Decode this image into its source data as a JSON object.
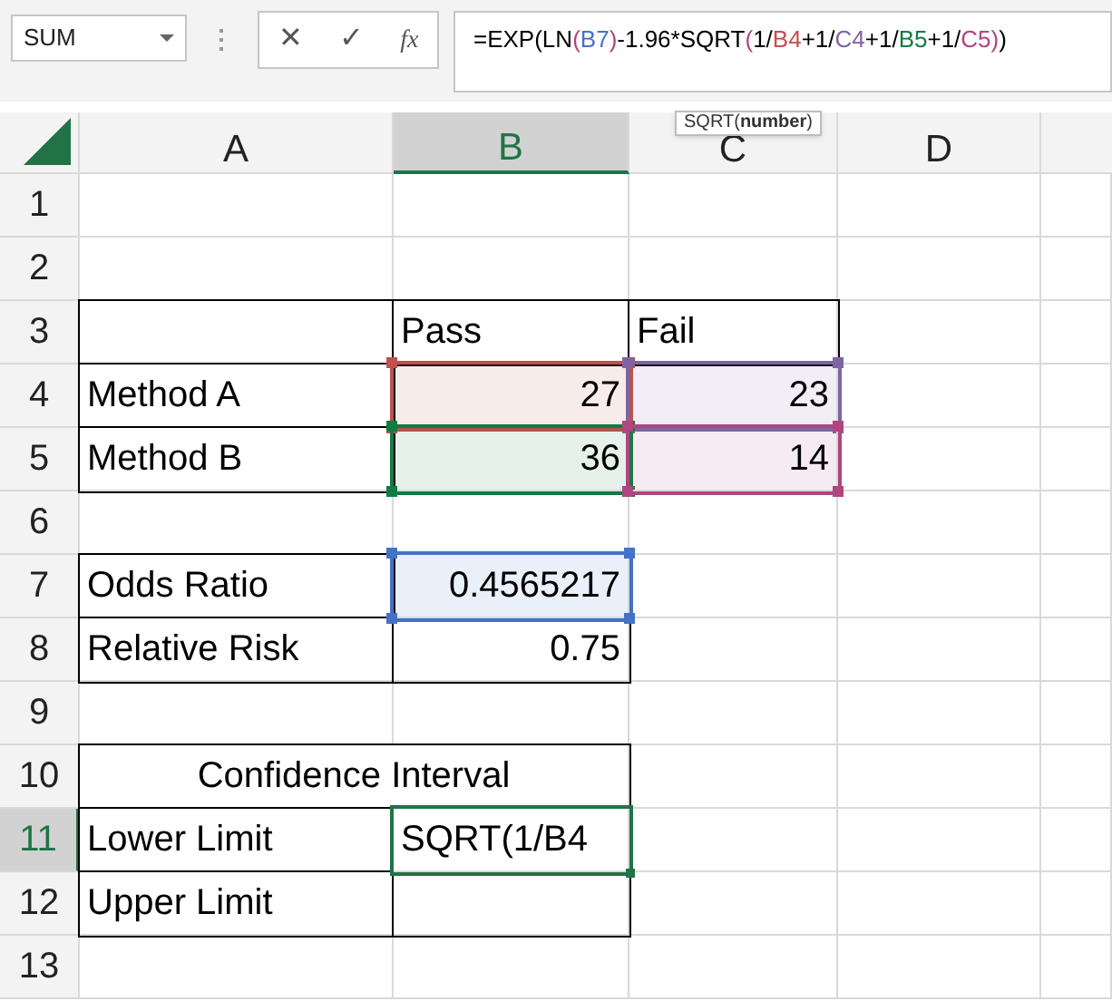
{
  "name_box": {
    "value": "SUM"
  },
  "formula_bar": {
    "buttons": [
      "✕",
      "✓",
      "fx"
    ],
    "segments": [
      {
        "text": "=EXP(LN"
      },
      {
        "text": "(",
        "color": "#b0457f"
      },
      {
        "text": "B7",
        "color": "#4472c4"
      },
      {
        "text": ")",
        "color": "#b0457f"
      },
      {
        "text": "-1.96*SQRT"
      },
      {
        "text": "(",
        "color": "#b0457f"
      },
      {
        "text": "1/"
      },
      {
        "text": "B4",
        "color": "#c0504d"
      },
      {
        "text": "+1/"
      },
      {
        "text": "C4",
        "color": "#8064a2"
      },
      {
        "text": "+1/"
      },
      {
        "text": "B5",
        "color": "#107c41"
      },
      {
        "text": "+1/"
      },
      {
        "text": "C5",
        "color": "#b0457f"
      },
      {
        "text": ")",
        "color": "#b0457f"
      },
      {
        "text": ")"
      }
    ]
  },
  "tooltip": {
    "function": "SQRT(",
    "argument": "number",
    "close": ")"
  },
  "columns": [
    {
      "label": "A",
      "selected": false
    },
    {
      "label": "B",
      "selected": true
    },
    {
      "label": "C",
      "selected": false
    },
    {
      "label": "D",
      "selected": false
    }
  ],
  "rows": [
    {
      "label": "1",
      "selected": false,
      "cells": [
        null,
        null,
        null,
        null
      ]
    },
    {
      "label": "2",
      "selected": false,
      "cells": [
        null,
        null,
        null,
        null
      ]
    },
    {
      "label": "3",
      "selected": false,
      "cells": [
        {
          "bordered": true
        },
        {
          "text": "Pass",
          "bordered": true
        },
        {
          "text": "Fail",
          "bordered": true
        },
        null
      ]
    },
    {
      "label": "4",
      "selected": false,
      "cells": [
        {
          "text": "Method A",
          "bordered": true
        },
        {
          "text": "27",
          "kind": "number",
          "color": "#c0504d"
        },
        {
          "text": "23",
          "kind": "number",
          "color": "#8064a2"
        },
        null
      ]
    },
    {
      "label": "5",
      "selected": false,
      "cells": [
        {
          "text": "Method B",
          "bordered": true
        },
        {
          "text": "36",
          "kind": "number",
          "color": "#107c41"
        },
        {
          "text": "14",
          "kind": "number",
          "color": "#b0457f"
        },
        null
      ]
    },
    {
      "label": "6",
      "selected": false,
      "cells": [
        null,
        null,
        null,
        null
      ]
    },
    {
      "label": "7",
      "selected": false,
      "cells": [
        {
          "text": "Odds Ratio",
          "bordered": true
        },
        {
          "text": "0.4565217",
          "kind": "number",
          "color": "#4472c4"
        },
        null,
        null
      ]
    },
    {
      "label": "8",
      "selected": false,
      "cells": [
        {
          "text": "Relative Risk",
          "bordered": true
        },
        {
          "text": "0.75",
          "kind": "number",
          "bordered": true
        },
        null,
        null
      ]
    },
    {
      "label": "9",
      "selected": false,
      "cells": [
        null,
        null,
        null,
        null
      ]
    },
    {
      "label": "10",
      "selected": false,
      "cells": [
        {
          "text": "Confidence Interval",
          "kind": "merged",
          "bordered": true
        },
        null,
        null
      ]
    },
    {
      "label": "11",
      "selected": true,
      "cells": [
        {
          "text": "Lower Limit",
          "bordered": true
        },
        {
          "text": "SQRT(1/B4",
          "active": true
        },
        null,
        null
      ]
    },
    {
      "label": "12",
      "selected": false,
      "cells": [
        {
          "text": "Upper Limit",
          "bordered": true
        },
        {
          "bordered": true
        },
        null,
        null
      ]
    },
    {
      "label": "13",
      "selected": false,
      "cells": [
        null,
        null,
        null,
        null
      ]
    }
  ]
}
